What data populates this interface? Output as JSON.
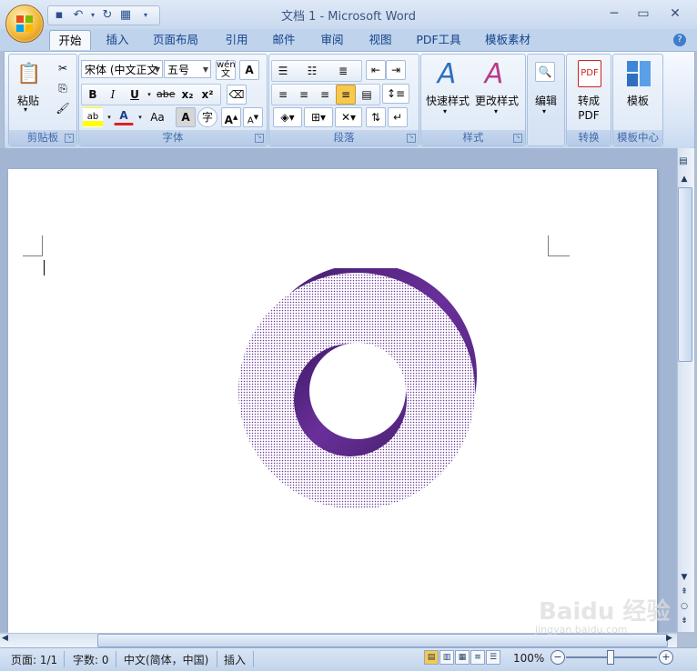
{
  "window": {
    "title": "文档 1 - Microsoft Word"
  },
  "quick_access": {
    "save_icon": "save-icon",
    "undo_icon": "undo-icon",
    "redo_icon": "redo-icon"
  },
  "tabs": [
    "开始",
    "插入",
    "页面布局",
    "引用",
    "邮件",
    "审阅",
    "视图",
    "PDF工具",
    "模板素材"
  ],
  "active_tab": "开始",
  "ribbon": {
    "clipboard": {
      "paste_label": "粘贴",
      "group_label": "剪贴板"
    },
    "font": {
      "font_name": "宋体 (中文正文",
      "font_size": "五号",
      "group_label": "字体",
      "bold": "B",
      "italic": "I",
      "underline": "U",
      "strike": "abe",
      "subscript": "x₂",
      "superscript": "x²",
      "grow": "A",
      "shrink": "A",
      "case": "Aa",
      "phonetic": "wén"
    },
    "paragraph": {
      "group_label": "段落"
    },
    "styles": {
      "quick_styles": "快速样式",
      "change_styles": "更改样式",
      "group_label": "样式"
    },
    "editing": {
      "label": "编辑"
    },
    "convert": {
      "label_line1": "转成",
      "label_line2": "PDF",
      "group_label": "转换"
    },
    "templates": {
      "label": "模板",
      "group_label": "模板中心"
    }
  },
  "status": {
    "page": "页面: 1/1",
    "words": "字数: 0",
    "language": "中文(简体，中国)",
    "mode": "插入",
    "zoom": "100%"
  },
  "colors": {
    "accent_purple": "#5a2a8a",
    "ribbon_blue": "#c2d6ee"
  },
  "watermark": {
    "brand": "Baidu 经验",
    "sub": "jingyan.baidu.com"
  }
}
